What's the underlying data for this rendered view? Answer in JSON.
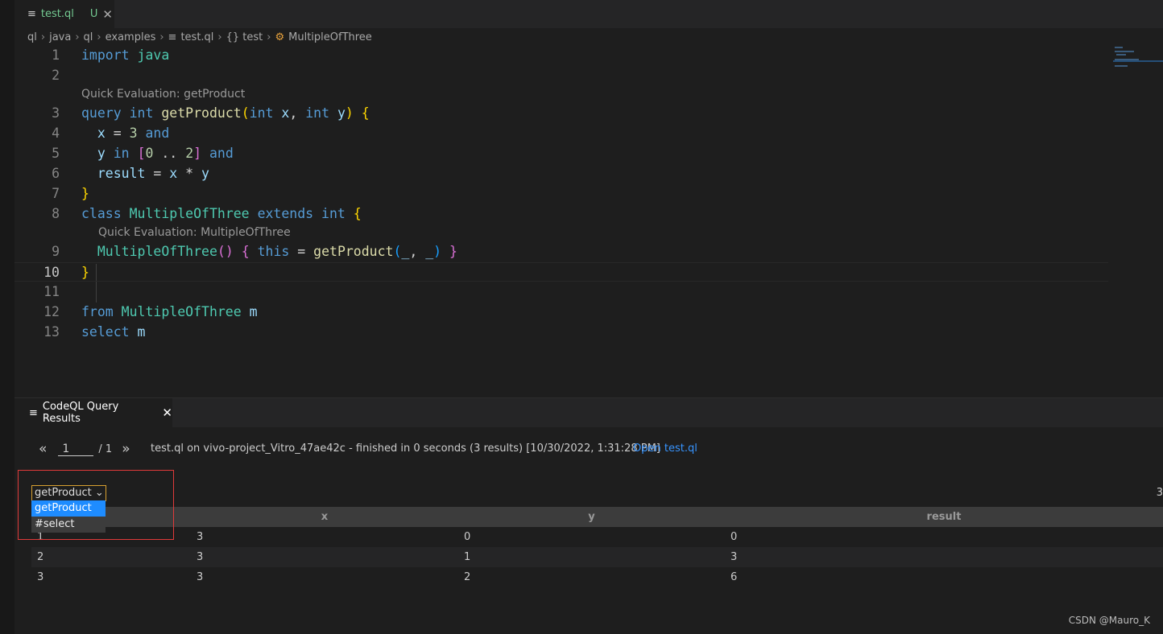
{
  "tab": {
    "name": "test.ql",
    "status": "U",
    "icon": "file-lines-icon"
  },
  "breadcrumb": [
    "ql",
    "java",
    "ql",
    "examples",
    "test.ql",
    "{} test",
    "MultipleOfThree"
  ],
  "code_lenses": [
    "Quick Evaluation: getProduct",
    "Quick Evaluation: MultipleOfThree"
  ],
  "lines": [
    {
      "n": "1",
      "t": [
        [
          "kw",
          "import "
        ],
        [
          "cls",
          "java"
        ]
      ]
    },
    {
      "n": "2",
      "t": []
    },
    {
      "n": "3",
      "t": [
        [
          "kw",
          "query "
        ],
        [
          "kw",
          "int "
        ],
        [
          "fn",
          "getProduct"
        ],
        [
          "br",
          "("
        ],
        [
          "kw",
          "int "
        ],
        [
          "var",
          "x"
        ],
        [
          "op",
          ", "
        ],
        [
          "kw",
          "int "
        ],
        [
          "var",
          "y"
        ],
        [
          "br",
          ")"
        ],
        [
          "op",
          " "
        ],
        [
          "br",
          "{"
        ]
      ]
    },
    {
      "n": "4",
      "t": [
        [
          "op",
          "  "
        ],
        [
          "var",
          "x"
        ],
        [
          "op",
          " = "
        ],
        [
          "num",
          "3"
        ],
        [
          "op",
          " "
        ],
        [
          "kw",
          "and"
        ]
      ]
    },
    {
      "n": "5",
      "t": [
        [
          "op",
          "  "
        ],
        [
          "var",
          "y"
        ],
        [
          "op",
          " "
        ],
        [
          "kw",
          "in"
        ],
        [
          "op",
          " "
        ],
        [
          "br2",
          "["
        ],
        [
          "num",
          "0"
        ],
        [
          "op",
          " .. "
        ],
        [
          "num",
          "2"
        ],
        [
          "br2",
          "]"
        ],
        [
          "op",
          " "
        ],
        [
          "kw",
          "and"
        ]
      ]
    },
    {
      "n": "6",
      "t": [
        [
          "op",
          "  "
        ],
        [
          "var",
          "result"
        ],
        [
          "op",
          " = "
        ],
        [
          "var",
          "x"
        ],
        [
          "op",
          " * "
        ],
        [
          "var",
          "y"
        ]
      ]
    },
    {
      "n": "7",
      "t": [
        [
          "br",
          "}"
        ]
      ]
    },
    {
      "n": "8",
      "t": [
        [
          "kw",
          "class "
        ],
        [
          "cls",
          "MultipleOfThree "
        ],
        [
          "kw",
          "extends "
        ],
        [
          "kw",
          "int "
        ],
        [
          "br",
          "{"
        ]
      ]
    },
    {
      "n": "9",
      "t": [
        [
          "op",
          "  "
        ],
        [
          "cls",
          "MultipleOfThree"
        ],
        [
          "br2",
          "()"
        ],
        [
          "op",
          " "
        ],
        [
          "br2",
          "{"
        ],
        [
          "op",
          " "
        ],
        [
          "kw",
          "this"
        ],
        [
          "op",
          " = "
        ],
        [
          "fn",
          "getProduct"
        ],
        [
          "br3",
          "("
        ],
        [
          "var",
          "_"
        ],
        [
          "op",
          ", "
        ],
        [
          "var",
          "_"
        ],
        [
          "br3",
          ")"
        ],
        [
          "op",
          " "
        ],
        [
          "br2",
          "}"
        ]
      ]
    },
    {
      "n": "10",
      "t": [
        [
          "br",
          "}"
        ]
      ]
    },
    {
      "n": "11",
      "t": []
    },
    {
      "n": "12",
      "t": [
        [
          "kw",
          "from "
        ],
        [
          "cls",
          "MultipleOfThree "
        ],
        [
          "var",
          "m"
        ]
      ]
    },
    {
      "n": "13",
      "t": [
        [
          "kw",
          "select "
        ],
        [
          "var",
          "m"
        ]
      ]
    }
  ],
  "panel": {
    "tab_label": "CodeQL Query Results",
    "pager": {
      "prev": "«",
      "page": "1",
      "total": "/ 1",
      "next": "»"
    },
    "status": "test.ql on vivo-project_Vitro_47ae42c - finished in 0 seconds (3 results) [10/30/2022, 1:31:28 PM]",
    "open_link": "Open test.ql",
    "result_set": {
      "selected": "getProduct",
      "options": [
        "getProduct",
        "#select"
      ]
    },
    "count": "3",
    "columns": [
      "#",
      "x",
      "y",
      "result"
    ],
    "rows": [
      [
        "1",
        "3",
        "0",
        "0"
      ],
      [
        "2",
        "3",
        "1",
        "3"
      ],
      [
        "3",
        "3",
        "2",
        "6"
      ]
    ]
  },
  "watermark": "CSDN @Mauro_K"
}
